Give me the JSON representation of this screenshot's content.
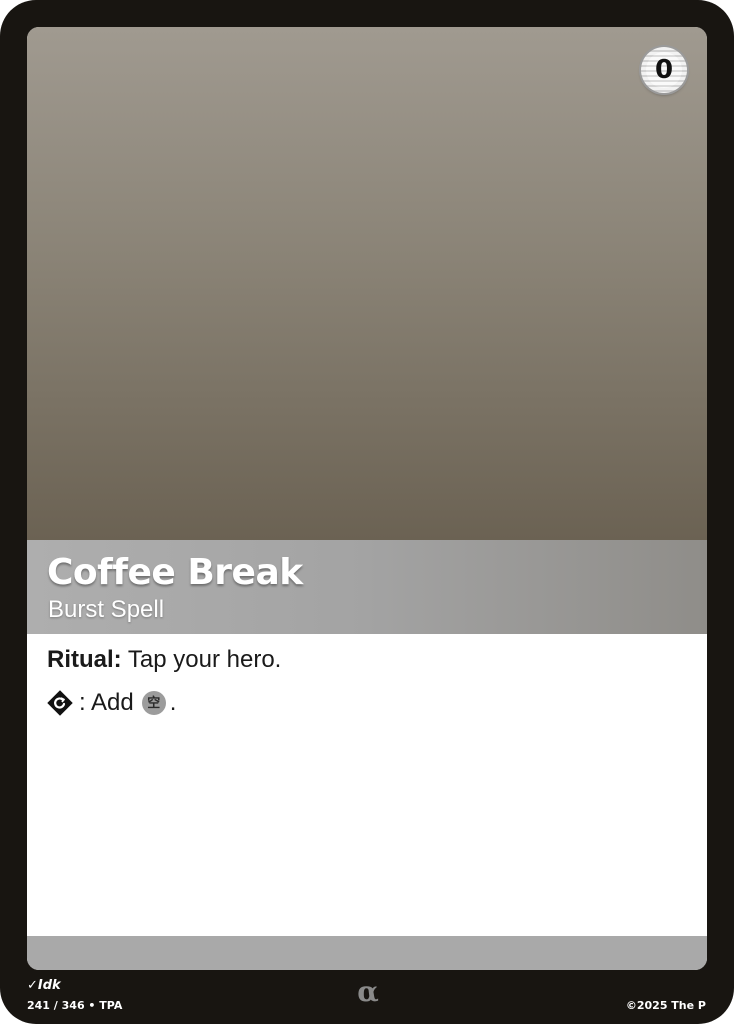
{
  "card": {
    "cost": "0",
    "name": "Coffee Break",
    "type_line": "Burst Spell",
    "rules": {
      "line1": {
        "keyword": "Ritual",
        "separator": ":",
        "text": " Tap your hero."
      },
      "line2": {
        "cost_icon": "tap-icon",
        "separator": ":",
        "text": " Add",
        "mana_icon": "void-mana-icon",
        "mana_glyph": "空",
        "end": "."
      }
    }
  },
  "footer": {
    "artist": "Idk",
    "collector_number": "241 / 346 • TPA",
    "rarity_symbol": "α",
    "copyright": "©2025 The P"
  },
  "colors": {
    "border": "#181511",
    "art_top": "#a09a90",
    "art_bottom": "#6b6253",
    "title_band": "#a3a3a3",
    "bottom_band": "#a9a9a9",
    "mana_void": "#9c9c9c"
  }
}
